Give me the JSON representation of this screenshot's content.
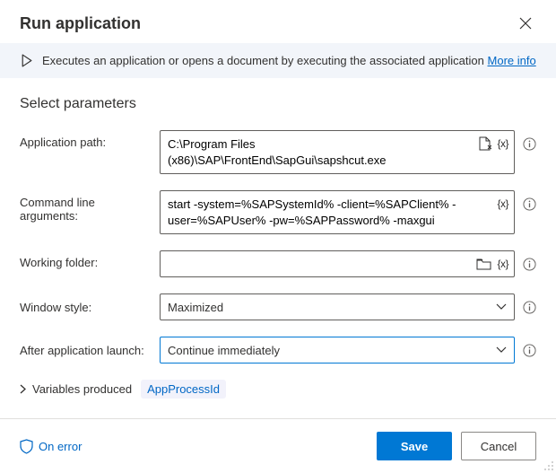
{
  "header": {
    "title": "Run application"
  },
  "banner": {
    "text": "Executes an application or opens a document by executing the associated application",
    "more_info": "More info"
  },
  "section": {
    "title": "Select parameters"
  },
  "fields": {
    "app_path": {
      "label": "Application path:",
      "value": "C:\\Program Files (x86)\\SAP\\FrontEnd\\SapGui\\sapshcut.exe"
    },
    "args": {
      "label": "Command line arguments:",
      "value": "start -system=%SAPSystemId% -client=%SAPClient% -user=%SAPUser% -pw=%SAPPassword% -maxgui"
    },
    "working_folder": {
      "label": "Working folder:",
      "value": ""
    },
    "window_style": {
      "label": "Window style:",
      "value": "Maximized"
    },
    "after_launch": {
      "label": "After application launch:",
      "value": "Continue immediately"
    }
  },
  "tokens": {
    "var": "{x}"
  },
  "variables": {
    "label": "Variables produced",
    "chip": "AppProcessId"
  },
  "footer": {
    "on_error": "On error",
    "save": "Save",
    "cancel": "Cancel"
  }
}
